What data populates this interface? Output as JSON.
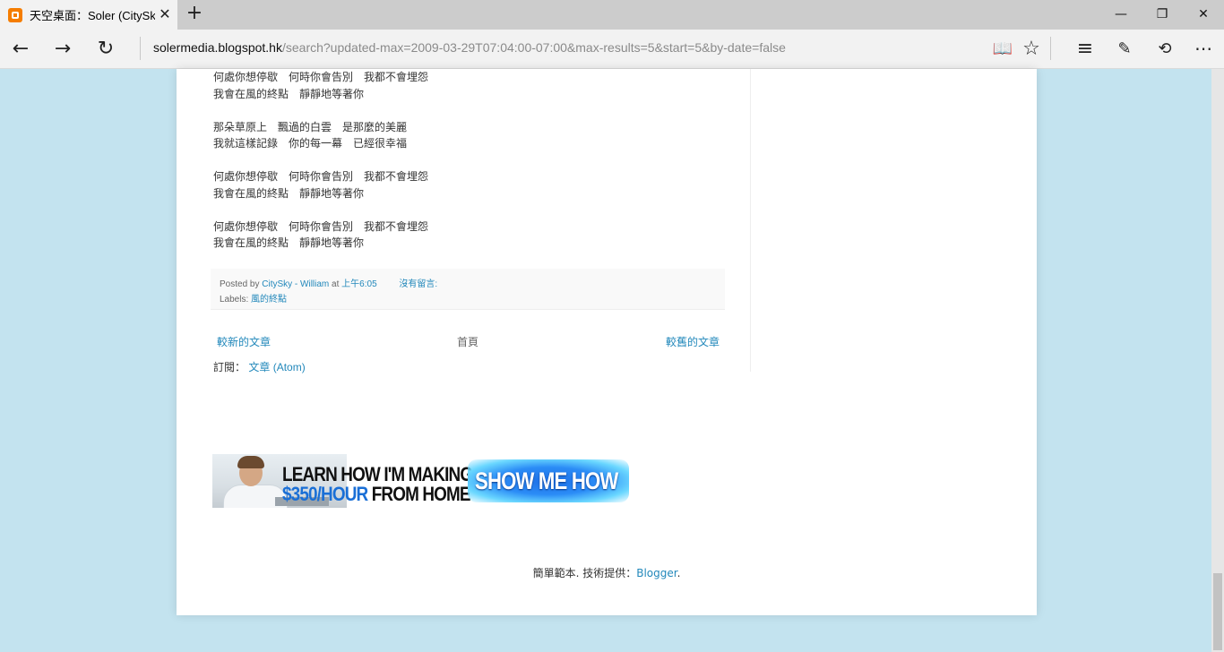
{
  "browser": {
    "tab_title": "天空桌面：Soler (CitySky",
    "tab_close": "✕",
    "new_tab": "+",
    "window_controls": {
      "minimize": "—",
      "restore": "❐",
      "close": "✕"
    },
    "nav": {
      "back": "←",
      "forward": "→",
      "refresh": "↻"
    },
    "address": {
      "host": "solermedia.blogspot.hk",
      "path": "/search?updated-max=2009-03-29T07:04:00-07:00&max-results=5&start=5&by-date=false"
    },
    "toolbar_icons": [
      "reading-view-icon",
      "favorite-star-icon",
      "hub-icon",
      "web-note-icon",
      "share-icon",
      "more-icon"
    ],
    "toolbar_glyphs": {
      "reading": "📖",
      "star": "☆",
      "hub": "≡",
      "note": "✎",
      "share": "⟲",
      "more": "⋯"
    }
  },
  "post": {
    "stanzas": [
      [
        "何處你想停歇　何時你會告別　我都不會埋怨",
        "我會在風的終點　靜靜地等著你"
      ],
      [
        "那朵草原上　飄過的白雲　是那麼的美麗",
        "我就這樣記錄　你的每一幕　已經很幸福"
      ],
      [
        "何處你想停歇　何時你會告別　我都不會埋怨",
        "我會在風的終點　靜靜地等著你"
      ],
      [
        "何處你想停歇　何時你會告別　我都不會埋怨",
        "我會在風的終點　靜靜地等著你"
      ]
    ],
    "footer": {
      "posted_by_label": "Posted by",
      "author": "CitySky - William",
      "at_label": "at",
      "time": "上午6:05",
      "comments": "沒有留言:",
      "labels_label": "Labels:",
      "label_tag": "風的終點"
    }
  },
  "pager": {
    "newer": "較新的文章",
    "home": "首頁",
    "older": "較舊的文章"
  },
  "feed": {
    "label": "訂閱：",
    "link": "文章 (Atom)"
  },
  "ad": {
    "line1": "LEARN HOW I'M MAKING",
    "line2_highlight": "$350/HOUR",
    "line2_rest": " FROM HOME",
    "button": "SHOW ME HOW"
  },
  "attribution": {
    "text": "簡單範本. 技術提供：",
    "link": "Blogger",
    "suffix": "."
  }
}
